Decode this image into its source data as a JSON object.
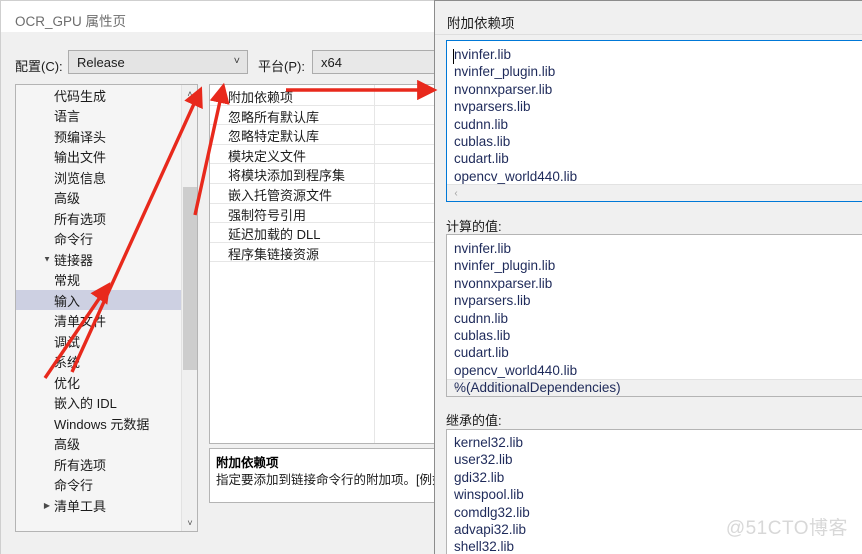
{
  "property_pages": {
    "window_title": "OCR_GPU 属性页",
    "config_label": "配置(C):",
    "config_value": "Release",
    "platform_label": "平台(P):",
    "platform_value": "x64",
    "tree": {
      "items": [
        {
          "label": "代码生成",
          "indent": 2,
          "arrow": "",
          "selected": false
        },
        {
          "label": "语言",
          "indent": 2,
          "arrow": "",
          "selected": false
        },
        {
          "label": "预编译头",
          "indent": 2,
          "arrow": "",
          "selected": false
        },
        {
          "label": "输出文件",
          "indent": 2,
          "arrow": "",
          "selected": false
        },
        {
          "label": "浏览信息",
          "indent": 2,
          "arrow": "",
          "selected": false
        },
        {
          "label": "高级",
          "indent": 2,
          "arrow": "",
          "selected": false
        },
        {
          "label": "所有选项",
          "indent": 2,
          "arrow": "",
          "selected": false
        },
        {
          "label": "命令行",
          "indent": 2,
          "arrow": "",
          "selected": false
        },
        {
          "label": "链接器",
          "indent": 1,
          "arrow": "▲",
          "selected": false
        },
        {
          "label": "常规",
          "indent": 2,
          "arrow": "",
          "selected": false
        },
        {
          "label": "输入",
          "indent": 2,
          "arrow": "",
          "selected": true
        },
        {
          "label": "清单文件",
          "indent": 2,
          "arrow": "",
          "selected": false
        },
        {
          "label": "调试",
          "indent": 2,
          "arrow": "",
          "selected": false
        },
        {
          "label": "系统",
          "indent": 2,
          "arrow": "",
          "selected": false
        },
        {
          "label": "优化",
          "indent": 2,
          "arrow": "",
          "selected": false
        },
        {
          "label": "嵌入的 IDL",
          "indent": 2,
          "arrow": "",
          "selected": false
        },
        {
          "label": "Windows 元数据",
          "indent": 2,
          "arrow": "",
          "selected": false
        },
        {
          "label": "高级",
          "indent": 2,
          "arrow": "",
          "selected": false
        },
        {
          "label": "所有选项",
          "indent": 2,
          "arrow": "",
          "selected": false
        },
        {
          "label": "命令行",
          "indent": 2,
          "arrow": "",
          "selected": false
        },
        {
          "label": "清单工具",
          "indent": 1,
          "arrow": "▶",
          "selected": false
        }
      ],
      "scroll_up_icon": "˄",
      "scroll_down_icon": "˅"
    },
    "properties": [
      "附加依赖项",
      "忽略所有默认库",
      "忽略特定默认库",
      "模块定义文件",
      "将模块添加到程序集",
      "嵌入托管资源文件",
      "强制符号引用",
      "延迟加载的 DLL",
      "程序集链接资源"
    ],
    "description": {
      "title": "附加依赖项",
      "text": "指定要添加到链接命令行的附加项。[例如"
    }
  },
  "edit_dialog": {
    "title": "附加依赖项",
    "edit_value_lines": [
      "nvinfer.lib",
      "nvinfer_plugin.lib",
      "nvonnxparser.lib",
      "nvparsers.lib",
      "cudnn.lib",
      "cublas.lib",
      "cudart.lib",
      "opencv_world440.lib"
    ],
    "evaluated_label": "计算的值:",
    "evaluated_lines": [
      "nvinfer.lib",
      "nvinfer_plugin.lib",
      "nvonnxparser.lib",
      "nvparsers.lib",
      "cudnn.lib",
      "cublas.lib",
      "cudart.lib",
      "opencv_world440.lib",
      "%(AdditionalDependencies)"
    ],
    "inherited_label": "继承的值:",
    "inherited_lines": [
      "kernel32.lib",
      "user32.lib",
      "gdi32.lib",
      "winspool.lib",
      "comdlg32.lib",
      "advapi32.lib",
      "shell32.lib"
    ],
    "hscroll_left_icon": "‹"
  },
  "watermark": "@51CTO博客",
  "colors": {
    "selection": "#cdd0e2",
    "focus_border": "#0078d7",
    "arrow_red": "#e8291c",
    "list_text": "#1e2a5a"
  }
}
